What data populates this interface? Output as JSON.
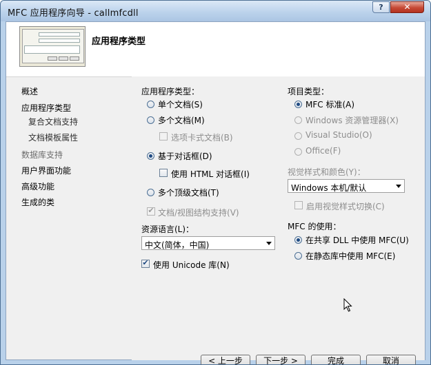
{
  "window": {
    "title": "MFC 应用程序向导 - callmfcdll",
    "help_label": "?",
    "close_label": "✕"
  },
  "header": {
    "page_title": "应用程序类型"
  },
  "nav": {
    "items": [
      {
        "label": "概述"
      },
      {
        "label": "应用程序类型"
      },
      {
        "label": "复合文档支持"
      },
      {
        "label": "文档模板属性"
      },
      {
        "label": "数据库支持"
      },
      {
        "label": "用户界面功能"
      },
      {
        "label": "高级功能"
      },
      {
        "label": "生成的类"
      }
    ]
  },
  "app_type": {
    "label": "应用程序类型：",
    "options": [
      {
        "label": "单个文档(S)",
        "selected": false
      },
      {
        "label": "多个文档(M)",
        "selected": false
      },
      {
        "label": "基于对话框(D)",
        "selected": true
      },
      {
        "label": "多个顶级文档(T)",
        "selected": false
      }
    ],
    "tabbed_docs": {
      "label": "选项卡式文档(B)",
      "checked": false,
      "enabled": false
    },
    "html_dialog": {
      "label": "使用 HTML 对话框(I)",
      "checked": false,
      "enabled": true
    },
    "doc_view": {
      "label": "文档/视图结构支持(V)",
      "checked": true,
      "enabled": false
    }
  },
  "resource_language": {
    "label": "资源语言(L)：",
    "value": "中文(简体，中国)"
  },
  "unicode": {
    "label": "使用 Unicode 库(N)",
    "checked": true
  },
  "project_type": {
    "label": "项目类型：",
    "options": [
      {
        "label": "MFC 标准(A)",
        "selected": true,
        "enabled": true
      },
      {
        "label": "Windows 资源管理器(X)",
        "selected": false,
        "enabled": false
      },
      {
        "label": "Visual Studio(O)",
        "selected": false,
        "enabled": false
      },
      {
        "label": "Office(F)",
        "selected": false,
        "enabled": false
      }
    ]
  },
  "visual_style": {
    "label": "视觉样式和颜色(Y)：",
    "value": "Windows 本机/默认",
    "switch": {
      "label": "启用视觉样式切换(C)",
      "checked": false,
      "enabled": false
    }
  },
  "mfc_use": {
    "label": "MFC 的使用：",
    "options": [
      {
        "label": "在共享 DLL 中使用 MFC(U)",
        "selected": true
      },
      {
        "label": "在静态库中使用 MFC(E)",
        "selected": false
      }
    ]
  },
  "buttons": {
    "back": "< 上一步",
    "next": "下一步 >",
    "finish": "完成",
    "cancel": "取消"
  }
}
